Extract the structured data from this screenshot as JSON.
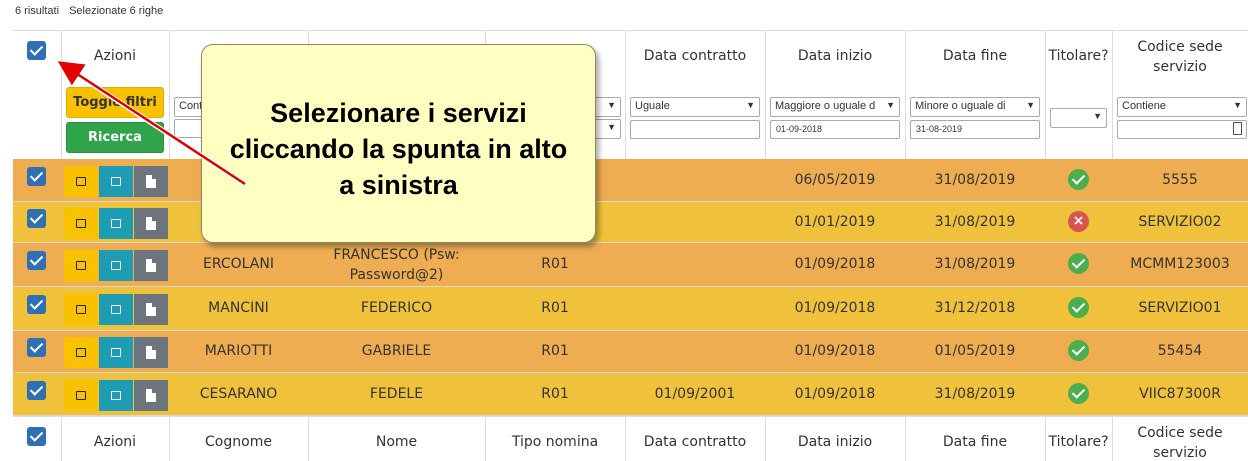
{
  "status": {
    "results": "6 risultati",
    "selected": "Selezionate 6 righe"
  },
  "columns": [
    "Azioni",
    "Cognome",
    "Nome",
    "Tipo nomina",
    "Data contratto",
    "Data inizio",
    "Data fine",
    "Titolare?",
    "Codice sede servizio"
  ],
  "header": {
    "actions": "Azioni",
    "data_contratto": "Data contratto",
    "data_inizio": "Data inizio",
    "data_fine": "Data fine",
    "titolare": "Titolare?",
    "codice_l1": "Codice sede",
    "codice_l2": "servizio"
  },
  "filters": {
    "toggle_label": "Toggle filtri",
    "search_label": "Ricerca",
    "cognome_op": "Contiene",
    "contratto_op": "Uguale",
    "inizio_op": "Maggiore o uguale d",
    "inizio_val": "01-09-2018",
    "fine_op": "Minore o uguale di",
    "fine_val": "31-08-2019",
    "codice_op": "Contiene"
  },
  "rows": [
    {
      "cognome": "",
      "nome": "",
      "tipo": "",
      "contratto": "",
      "inizio": "06/05/2019",
      "fine": "31/08/2019",
      "titolare": true,
      "codice": "5555"
    },
    {
      "cognome": "",
      "nome": "",
      "tipo": "",
      "contratto": "",
      "inizio": "01/01/2019",
      "fine": "31/08/2019",
      "titolare": false,
      "codice": "SERVIZIO02"
    },
    {
      "cognome": "ERCOLANI",
      "nome_l1": "FRANCESCO (Psw:",
      "nome_l2": "Password@2)",
      "tipo": "R01",
      "contratto": "",
      "inizio": "01/09/2018",
      "fine": "31/08/2019",
      "titolare": true,
      "codice": "MCMM123003"
    },
    {
      "cognome": "MANCINI",
      "nome": "FEDERICO",
      "tipo": "R01",
      "contratto": "",
      "inizio": "01/09/2018",
      "fine": "31/12/2018",
      "titolare": true,
      "codice": "SERVIZIO01"
    },
    {
      "cognome": "MARIOTTI",
      "nome": "GABRIELE",
      "tipo": "R01",
      "contratto": "",
      "inizio": "01/09/2018",
      "fine": "01/05/2019",
      "titolare": true,
      "codice": "55454"
    },
    {
      "cognome": "CESARANO",
      "nome": "FEDELE",
      "tipo": "R01",
      "contratto": "01/09/2001",
      "inizio": "01/09/2018",
      "fine": "31/08/2019",
      "titolare": true,
      "codice": "VIIC87300R"
    }
  ],
  "footer": {
    "actions": "Azioni",
    "cognome": "Cognome",
    "nome": "Nome",
    "tipo": "Tipo nomina",
    "contratto": "Data contratto",
    "inizio": "Data inizio",
    "fine": "Data fine",
    "titolare": "Titolare?",
    "codice_l1": "Codice sede",
    "codice_l2": "servizio"
  },
  "callout": {
    "line1": "Selezionare i servizi",
    "line2": "cliccando la spunta in alto",
    "line3": "a sinistra"
  },
  "colors": {
    "row_even": "#efad52",
    "row_odd": "#f0c23c",
    "checkbox": "#2f6fb3",
    "ok": "#4cae4c",
    "no": "#d9534f",
    "callout_bg": "#ffffc2",
    "arrow": "#e00000"
  },
  "icons": {
    "ok": "check-circle-icon",
    "no": "x-circle-icon",
    "edit": "pencil-square-icon",
    "doc": "file-icon"
  }
}
